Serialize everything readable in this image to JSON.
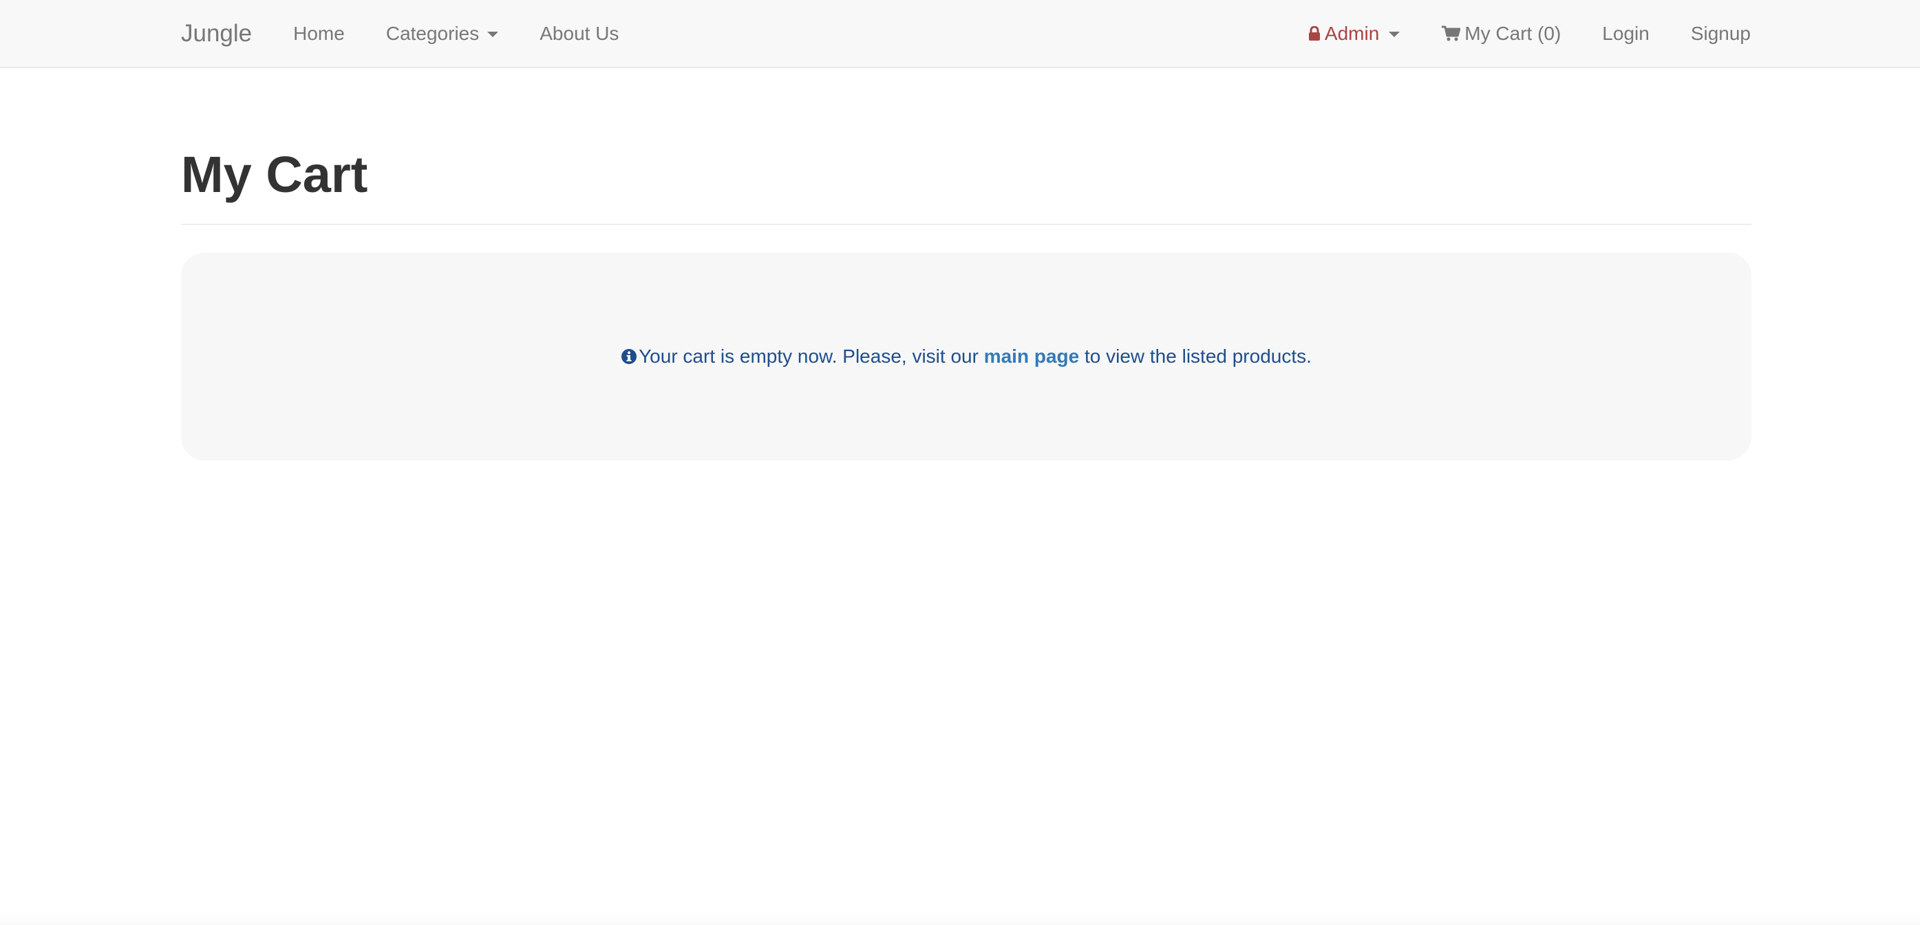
{
  "navbar": {
    "brand": "Jungle",
    "left_links": [
      {
        "label": "Home"
      },
      {
        "label": "Categories"
      },
      {
        "label": "About Us"
      }
    ],
    "admin_label": "Admin",
    "cart_label": "My Cart (0)",
    "login_label": "Login",
    "signup_label": "Signup"
  },
  "page": {
    "title": "My Cart",
    "empty_message_before": "Your cart is empty now. Please, visit our ",
    "empty_message_link": "main page",
    "empty_message_after": " to view the listed products."
  },
  "colors": {
    "navbar_bg": "#f8f8f8",
    "nav_text": "#777777",
    "admin_text": "#a94442",
    "message_text": "#1f4e8c",
    "link": "#337ab7",
    "jumbotron_bg": "#f7f7f7"
  },
  "icons": {
    "admin": "lock-icon",
    "cart": "shopping-cart-icon",
    "info": "info-circle-icon"
  }
}
